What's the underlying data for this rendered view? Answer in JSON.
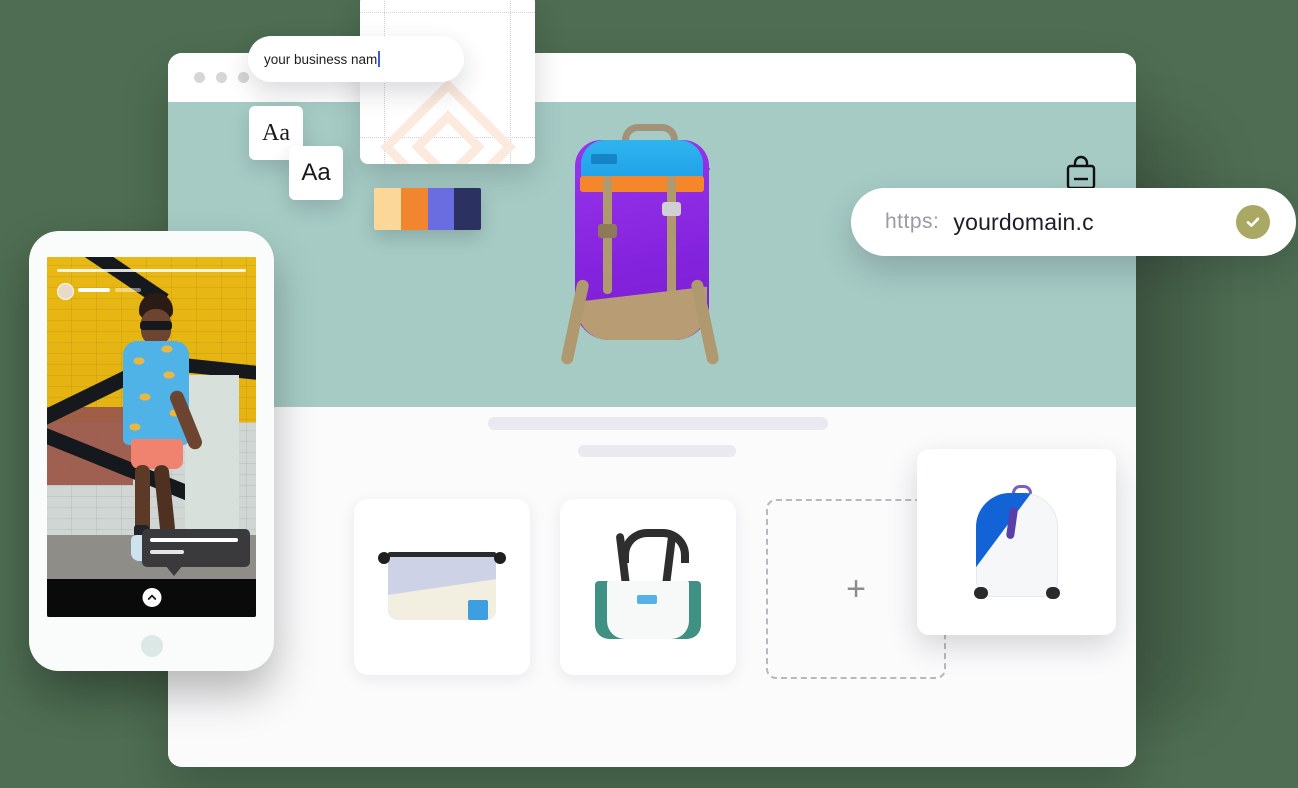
{
  "background_color": "#4e6d52",
  "browser": {
    "window_dots": [
      "dot-red",
      "dot-yellow",
      "dot-green"
    ],
    "hero": {
      "background_color": "#a6cbc5",
      "squiggle_icon": "wave-squiggle-icon",
      "cart_icon": "shopping-bag-icon",
      "product_image_alt": "purple-backpack"
    },
    "page": {
      "title_placeholder": "",
      "subtitle_placeholder": "",
      "products": [
        {
          "name": "zip-pouch",
          "alt": "lavender and cream zip pouch with blue label"
        },
        {
          "name": "tote-bag",
          "alt": "white and green tote bag with black handles"
        }
      ],
      "add_product_label": "+"
    }
  },
  "name_input": {
    "value": "your business nam",
    "placeholder": "your business name",
    "caret": true
  },
  "logo_card": {
    "mark_name": "diamond-logo-mark",
    "mark_color": "#fbeadd",
    "guides": "dotted-alignment-guides"
  },
  "font_cards": [
    {
      "sample": "Aa",
      "style": "serif"
    },
    {
      "sample": "Aa",
      "style": "sans-serif"
    }
  ],
  "palette": {
    "label": "brand-color-palette",
    "swatches": [
      "#fcd79a",
      "#f2862f",
      "#6a6de0",
      "#2b3160"
    ]
  },
  "domain_pill": {
    "scheme": "https:",
    "domain": "yourdomain.c",
    "status": "available",
    "check_icon": "check-circle-icon",
    "check_color": "#a9a963"
  },
  "phone": {
    "story": {
      "progress": "story-progress-bar",
      "avatar": "story-avatar",
      "username_placeholder": "",
      "photo_alt": "person in blue patterned sweater against yellow graffiti brick wall",
      "product_tag": {
        "line1": "",
        "line2": ""
      },
      "swipe_up_icon": "chevron-up-icon"
    },
    "home_button": "home-button"
  }
}
